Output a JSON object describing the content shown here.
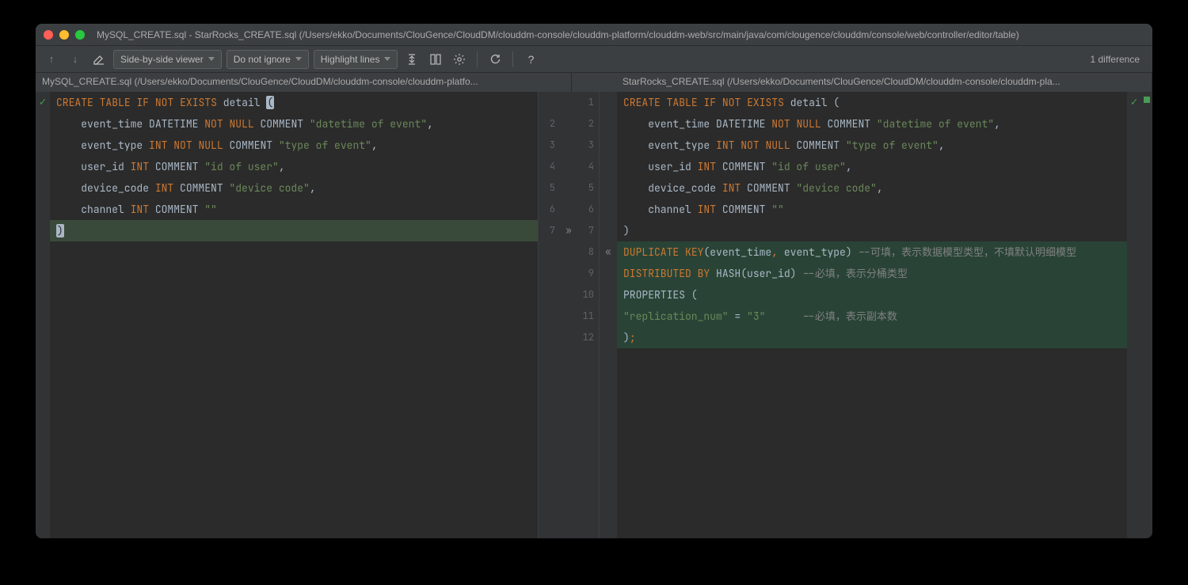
{
  "window": {
    "title": "MySQL_CREATE.sql - StarRocks_CREATE.sql (/Users/ekko/Documents/ClouGence/CloudDM/clouddm-console/clouddm-platform/clouddm-web/src/main/java/com/clougence/clouddm/console/web/controller/editor/table)"
  },
  "toolbar": {
    "viewer_mode": "Side-by-side viewer",
    "ignore_mode": "Do not ignore",
    "highlight_mode": "Highlight lines",
    "diff_count": "1 difference"
  },
  "tabs": {
    "left": "MySQL_CREATE.sql (/Users/ekko/Documents/ClouGence/CloudDM/clouddm-console/clouddm-platfo...",
    "right": "StarRocks_CREATE.sql (/Users/ekko/Documents/ClouGence/CloudDM/clouddm-console/clouddm-pla..."
  },
  "left_pane": {
    "line_numbers": [
      "",
      "2",
      "3",
      "4",
      "5",
      "6",
      "7"
    ],
    "lines": [
      {
        "tokens": [
          {
            "t": "CREATE",
            "c": "kw"
          },
          {
            "t": " ",
            "c": ""
          },
          {
            "t": "TABLE",
            "c": "kw"
          },
          {
            "t": " ",
            "c": ""
          },
          {
            "t": "IF",
            "c": "kw"
          },
          {
            "t": " ",
            "c": ""
          },
          {
            "t": "NOT",
            "c": "kw"
          },
          {
            "t": " ",
            "c": ""
          },
          {
            "t": "EXISTS",
            "c": "kw"
          },
          {
            "t": " detail ",
            "c": "ident"
          },
          {
            "t": "(",
            "c": "paren-hl"
          }
        ],
        "mod": false
      },
      {
        "tokens": [
          {
            "t": "    event_time ",
            "c": "ident"
          },
          {
            "t": "DATETIME",
            "c": "ident"
          },
          {
            "t": " ",
            "c": ""
          },
          {
            "t": "NOT",
            "c": "kw"
          },
          {
            "t": " ",
            "c": ""
          },
          {
            "t": "NULL",
            "c": "kw"
          },
          {
            "t": " COMMENT ",
            "c": "ident"
          },
          {
            "t": "\"datetime of event\"",
            "c": "str"
          },
          {
            "t": ",",
            "c": "ident"
          }
        ],
        "mod": false
      },
      {
        "tokens": [
          {
            "t": "    event_type ",
            "c": "ident"
          },
          {
            "t": "INT",
            "c": "kw"
          },
          {
            "t": " ",
            "c": ""
          },
          {
            "t": "NOT",
            "c": "kw"
          },
          {
            "t": " ",
            "c": ""
          },
          {
            "t": "NULL",
            "c": "kw"
          },
          {
            "t": " COMMENT ",
            "c": "ident"
          },
          {
            "t": "\"type of event\"",
            "c": "str"
          },
          {
            "t": ",",
            "c": "ident"
          }
        ],
        "mod": false
      },
      {
        "tokens": [
          {
            "t": "    user_id ",
            "c": "ident"
          },
          {
            "t": "INT",
            "c": "kw"
          },
          {
            "t": " COMMENT ",
            "c": "ident"
          },
          {
            "t": "\"id of user\"",
            "c": "str"
          },
          {
            "t": ",",
            "c": "ident"
          }
        ],
        "mod": false
      },
      {
        "tokens": [
          {
            "t": "    device_code ",
            "c": "ident"
          },
          {
            "t": "INT",
            "c": "kw"
          },
          {
            "t": " COMMENT ",
            "c": "ident"
          },
          {
            "t": "\"device code\"",
            "c": "str"
          },
          {
            "t": ",",
            "c": "ident"
          }
        ],
        "mod": false
      },
      {
        "tokens": [
          {
            "t": "    channel ",
            "c": "ident"
          },
          {
            "t": "INT",
            "c": "kw"
          },
          {
            "t": " COMMENT ",
            "c": "ident"
          },
          {
            "t": "\"\"",
            "c": "str"
          }
        ],
        "mod": false
      },
      {
        "tokens": [
          {
            "t": ")",
            "c": "paren-hl"
          }
        ],
        "mod": true
      }
    ]
  },
  "right_pane": {
    "line_numbers": [
      "1",
      "2",
      "3",
      "4",
      "5",
      "6",
      "7",
      "8",
      "9",
      "10",
      "11",
      "12"
    ],
    "lines": [
      {
        "tokens": [
          {
            "t": "CREATE",
            "c": "kw"
          },
          {
            "t": " ",
            "c": ""
          },
          {
            "t": "TABLE",
            "c": "kw"
          },
          {
            "t": " ",
            "c": ""
          },
          {
            "t": "IF",
            "c": "kw"
          },
          {
            "t": " ",
            "c": ""
          },
          {
            "t": "NOT",
            "c": "kw"
          },
          {
            "t": " ",
            "c": ""
          },
          {
            "t": "EXISTS",
            "c": "kw"
          },
          {
            "t": " detail (",
            "c": "ident"
          }
        ],
        "mod": false
      },
      {
        "tokens": [
          {
            "t": "    event_time ",
            "c": "ident"
          },
          {
            "t": "DATETIME",
            "c": "ident"
          },
          {
            "t": " ",
            "c": ""
          },
          {
            "t": "NOT",
            "c": "kw"
          },
          {
            "t": " ",
            "c": ""
          },
          {
            "t": "NULL",
            "c": "kw"
          },
          {
            "t": " COMMENT ",
            "c": "ident"
          },
          {
            "t": "\"datetime of event\"",
            "c": "str"
          },
          {
            "t": ",",
            "c": "ident"
          }
        ],
        "mod": false
      },
      {
        "tokens": [
          {
            "t": "    event_type ",
            "c": "ident"
          },
          {
            "t": "INT",
            "c": "kw"
          },
          {
            "t": " ",
            "c": ""
          },
          {
            "t": "NOT",
            "c": "kw"
          },
          {
            "t": " ",
            "c": ""
          },
          {
            "t": "NULL",
            "c": "kw"
          },
          {
            "t": " COMMENT ",
            "c": "ident"
          },
          {
            "t": "\"type of event\"",
            "c": "str"
          },
          {
            "t": ",",
            "c": "ident"
          }
        ],
        "mod": false
      },
      {
        "tokens": [
          {
            "t": "    user_id ",
            "c": "ident"
          },
          {
            "t": "INT",
            "c": "kw"
          },
          {
            "t": " COMMENT ",
            "c": "ident"
          },
          {
            "t": "\"id of user\"",
            "c": "str"
          },
          {
            "t": ",",
            "c": "ident"
          }
        ],
        "mod": false
      },
      {
        "tokens": [
          {
            "t": "    device_code ",
            "c": "ident"
          },
          {
            "t": "INT",
            "c": "kw"
          },
          {
            "t": " COMMENT ",
            "c": "ident"
          },
          {
            "t": "\"device code\"",
            "c": "str"
          },
          {
            "t": ",",
            "c": "ident"
          }
        ],
        "mod": false
      },
      {
        "tokens": [
          {
            "t": "    channel ",
            "c": "ident"
          },
          {
            "t": "INT",
            "c": "kw"
          },
          {
            "t": " COMMENT ",
            "c": "ident"
          },
          {
            "t": "\"\"",
            "c": "str"
          }
        ],
        "mod": false
      },
      {
        "tokens": [
          {
            "t": ")",
            "c": "ident"
          }
        ],
        "mod": false
      },
      {
        "tokens": [
          {
            "t": "DUPLICATE",
            "c": "kw"
          },
          {
            "t": " ",
            "c": ""
          },
          {
            "t": "KEY",
            "c": "kw"
          },
          {
            "t": "(event_time",
            "c": "ident"
          },
          {
            "t": ",",
            "c": "kw"
          },
          {
            "t": " event_type) ",
            "c": "ident"
          },
          {
            "t": "--可填，表示数据模型类型，不填默认明细模型",
            "c": "comment"
          }
        ],
        "add": true
      },
      {
        "tokens": [
          {
            "t": "DISTRIBUTED",
            "c": "kw"
          },
          {
            "t": " ",
            "c": ""
          },
          {
            "t": "BY",
            "c": "kw"
          },
          {
            "t": " HASH(user_id) ",
            "c": "ident"
          },
          {
            "t": "--必填，表示分桶类型",
            "c": "comment"
          }
        ],
        "add": true
      },
      {
        "tokens": [
          {
            "t": "PROPERTIES (",
            "c": "ident"
          }
        ],
        "add": true
      },
      {
        "tokens": [
          {
            "t": "\"replication_num\"",
            "c": "str"
          },
          {
            "t": " = ",
            "c": "ident"
          },
          {
            "t": "\"3\"",
            "c": "str"
          },
          {
            "t": "      ",
            "c": ""
          },
          {
            "t": "--必填，表示副本数",
            "c": "comment"
          }
        ],
        "add": true
      },
      {
        "tokens": [
          {
            "t": ")",
            "c": "ident"
          },
          {
            "t": ";",
            "c": "kw"
          }
        ],
        "add": true
      }
    ]
  },
  "markers": {
    "left_check": "✓",
    "right_check": "✓",
    "insert_arrow_left": "»",
    "insert_arrow_right": "«"
  }
}
